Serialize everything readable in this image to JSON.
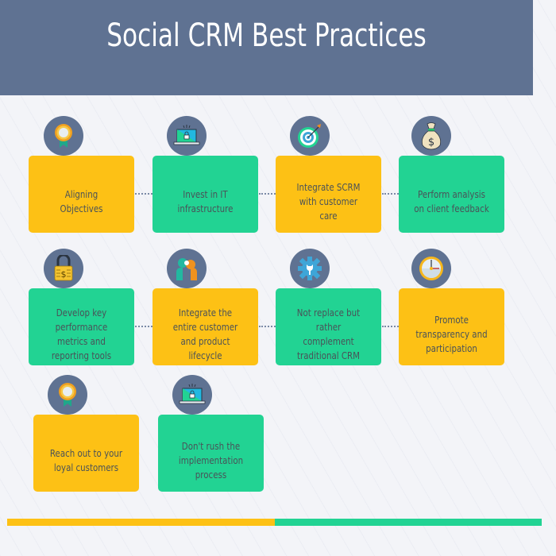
{
  "header": {
    "title": "Social CRM Best Practices"
  },
  "colors": {
    "header": "#5f7292",
    "yellow": "#fdc115",
    "green": "#22d393",
    "icon_bg": "#5f7292",
    "text": "#4a5258"
  },
  "steps": [
    {
      "label": "Aligning Objectives",
      "color": "yellow",
      "icon": "award-ribbon-icon"
    },
    {
      "label": "Invest in IT infrastructure",
      "color": "green",
      "icon": "laptop-lock-icon"
    },
    {
      "label": "Integrate SCRM with customer care",
      "color": "yellow",
      "icon": "target-arrow-icon"
    },
    {
      "label": "Perform analysis on client feedback",
      "color": "green",
      "icon": "money-bag-icon"
    },
    {
      "label": "Develop key performance metrics and reporting tools",
      "color": "green",
      "icon": "padlock-dollar-icon"
    },
    {
      "label": "Integrate the entire customer and product lifecycle",
      "color": "yellow",
      "icon": "people-talking-icon"
    },
    {
      "label": "Not replace but rather complement traditional CRM",
      "color": "green",
      "icon": "gear-wrench-icon"
    },
    {
      "label": "Promote transparency and participation",
      "color": "yellow",
      "icon": "clock-icon"
    },
    {
      "label": "Reach out to your loyal customers",
      "color": "yellow",
      "icon": "award-ribbon-icon"
    },
    {
      "label": "Don't rush the implementation process",
      "color": "green",
      "icon": "laptop-lock-icon"
    }
  ],
  "footer_bar": {
    "segments": [
      {
        "color": "yellow",
        "fraction": 0.5
      },
      {
        "color": "green",
        "fraction": 0.5
      }
    ]
  }
}
